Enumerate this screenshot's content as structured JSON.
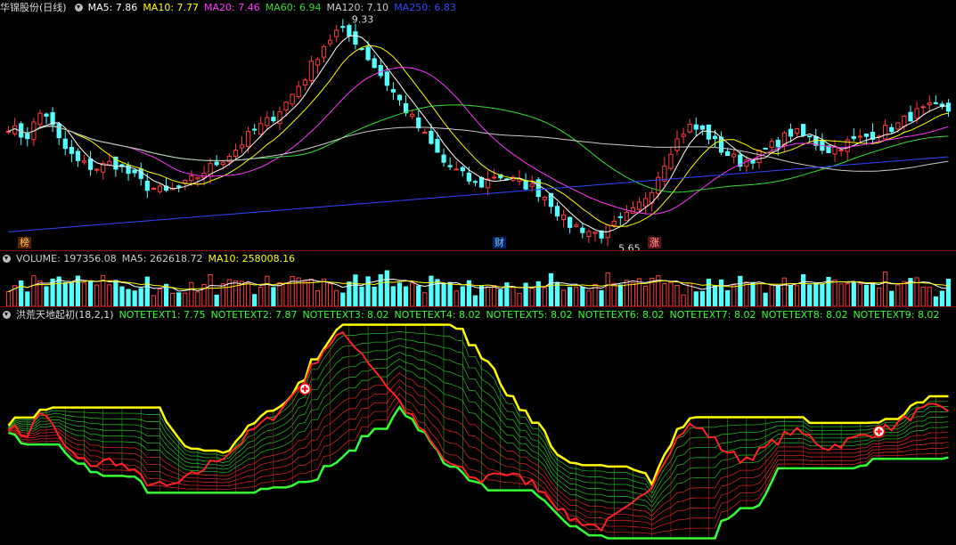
{
  "colors": {
    "up": "#ff3b3b",
    "down": "#54ffff",
    "ma5": "#ffffff",
    "ma10": "#ffff00",
    "ma20": "#ff33ff",
    "ma60": "#33dd33",
    "ma120": "#cccccc",
    "ma250": "#3344ff",
    "grid": "#8a0000",
    "note": "#33ff33",
    "hi": "#ffff00",
    "lo": "#33ff33"
  },
  "main": {
    "title": "华锦股份(日线)",
    "ma_labels": [
      {
        "text": "MA5: 7.86",
        "color": "#ffffff"
      },
      {
        "text": "MA10: 7.77",
        "color": "#ffff00"
      },
      {
        "text": "MA20: 7.46",
        "color": "#ff33ff"
      },
      {
        "text": "MA60: 6.94",
        "color": "#33dd33"
      },
      {
        "text": "MA120: 7.10",
        "color": "#cccccc"
      },
      {
        "text": "MA250: 6.83",
        "color": "#3344ff"
      }
    ],
    "high_label": "9.33",
    "low_label": "5.65",
    "markers": [
      {
        "text": "榜",
        "color": "#ffcc66",
        "bg": "#552200"
      },
      {
        "text": "财",
        "color": "#88ccff",
        "bg": "#002266"
      },
      {
        "text": "涨",
        "color": "#ffaaaa",
        "bg": "#661111"
      }
    ]
  },
  "volume": {
    "labels": [
      {
        "text": "VOLUME: 197356.08",
        "color": "#cccccc"
      },
      {
        "text": "MA5: 262618.72",
        "color": "#cccccc"
      },
      {
        "text": "MA10: 258008.16",
        "color": "#ffff00"
      }
    ]
  },
  "indicator": {
    "title": "洪荒天地起初(18,2,1)",
    "notes": [
      "NOTETEXT1: 7.75",
      "NOTETEXT2: 7.87",
      "NOTETEXT3: 8.02",
      "NOTETEXT4: 8.02",
      "NOTETEXT5: 8.02",
      "NOTETEXT6: 8.02",
      "NOTETEXT7: 8.02",
      "NOTETEXT8: 8.02",
      "NOTETEXT9: 8.02"
    ]
  },
  "chart_data": [
    {
      "type": "candlestick",
      "title": "华锦股份(日线)",
      "price_range": [
        5.65,
        9.33
      ],
      "close_path": [
        7.6,
        7.4,
        7.9,
        7.3,
        7.0,
        6.9,
        7.0,
        6.8,
        6.6,
        6.5,
        6.6,
        6.8,
        7.0,
        7.2,
        7.5,
        7.7,
        8.0,
        8.4,
        8.9,
        9.2,
        9.0,
        8.6,
        8.2,
        7.8,
        7.4,
        7.0,
        6.8,
        6.6,
        6.8,
        6.7,
        6.6,
        6.4,
        6.0,
        5.9,
        5.8,
        6.0,
        6.2,
        6.6,
        7.2,
        7.6,
        7.5,
        7.2,
        7.0,
        7.1,
        7.3,
        7.5,
        7.4,
        7.2,
        7.3,
        7.4,
        7.5,
        7.6,
        7.8,
        7.9,
        7.86
      ],
      "moving_averages": {
        "MA5": 7.86,
        "MA10": 7.77,
        "MA20": 7.46,
        "MA60": 6.94,
        "MA120": 7.1,
        "MA250": 6.83
      }
    },
    {
      "type": "bar",
      "title": "VOLUME",
      "values_now": {
        "VOLUME": 197356.08,
        "MA5": 262618.72,
        "MA10": 258008.16
      }
    },
    {
      "type": "line",
      "title": "洪荒天地起初(18,2,1)",
      "notes": {
        "NOTETEXT1": 7.75,
        "NOTETEXT2": 7.87,
        "NOTETEXT3": 8.02,
        "NOTETEXT4": 8.02,
        "NOTETEXT5": 8.02,
        "NOTETEXT6": 8.02,
        "NOTETEXT7": 8.02,
        "NOTETEXT8": 8.02,
        "NOTETEXT9": 8.02
      }
    }
  ]
}
